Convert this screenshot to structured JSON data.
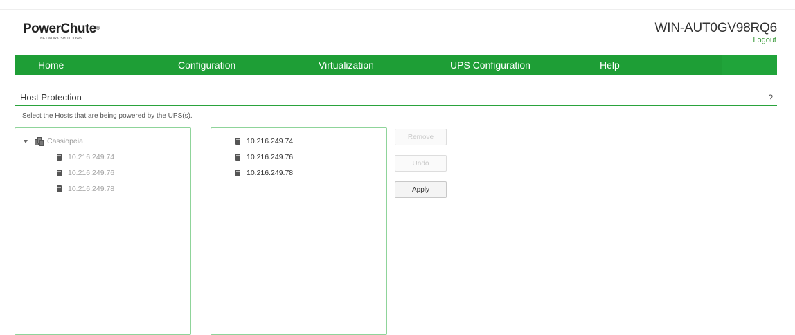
{
  "header": {
    "logo_text": "PowerChute",
    "logo_mark": "®",
    "logo_subtitle": "NETWORK SHUTDOWN",
    "hostname": "WIN-AUT0GV98RQ6",
    "logout_label": "Logout"
  },
  "nav": {
    "items": [
      {
        "label": "Home"
      },
      {
        "label": "Configuration"
      },
      {
        "label": "Virtualization"
      },
      {
        "label": "UPS Configuration"
      },
      {
        "label": "Help"
      }
    ]
  },
  "section": {
    "title": "Host Protection",
    "help": "?",
    "instructions": "Select the Hosts that are being powered by the UPS(s)."
  },
  "available_tree": {
    "root": {
      "label": "Cassiopeia",
      "icon": "cluster-icon"
    },
    "hosts": [
      {
        "label": "10.216.249.74",
        "icon": "host-icon"
      },
      {
        "label": "10.216.249.76",
        "icon": "host-icon"
      },
      {
        "label": "10.216.249.78",
        "icon": "host-icon"
      }
    ]
  },
  "selected_list": {
    "hosts": [
      {
        "label": "10.216.249.74",
        "icon": "host-icon"
      },
      {
        "label": "10.216.249.76",
        "icon": "host-icon"
      },
      {
        "label": "10.216.249.78",
        "icon": "host-icon"
      }
    ]
  },
  "actions": {
    "remove_label": "Remove",
    "undo_label": "Undo",
    "apply_label": "Apply"
  },
  "colors": {
    "nav_background": "#1e9e36",
    "accent": "#2aa33c",
    "panel_border": "#8fd49a"
  }
}
